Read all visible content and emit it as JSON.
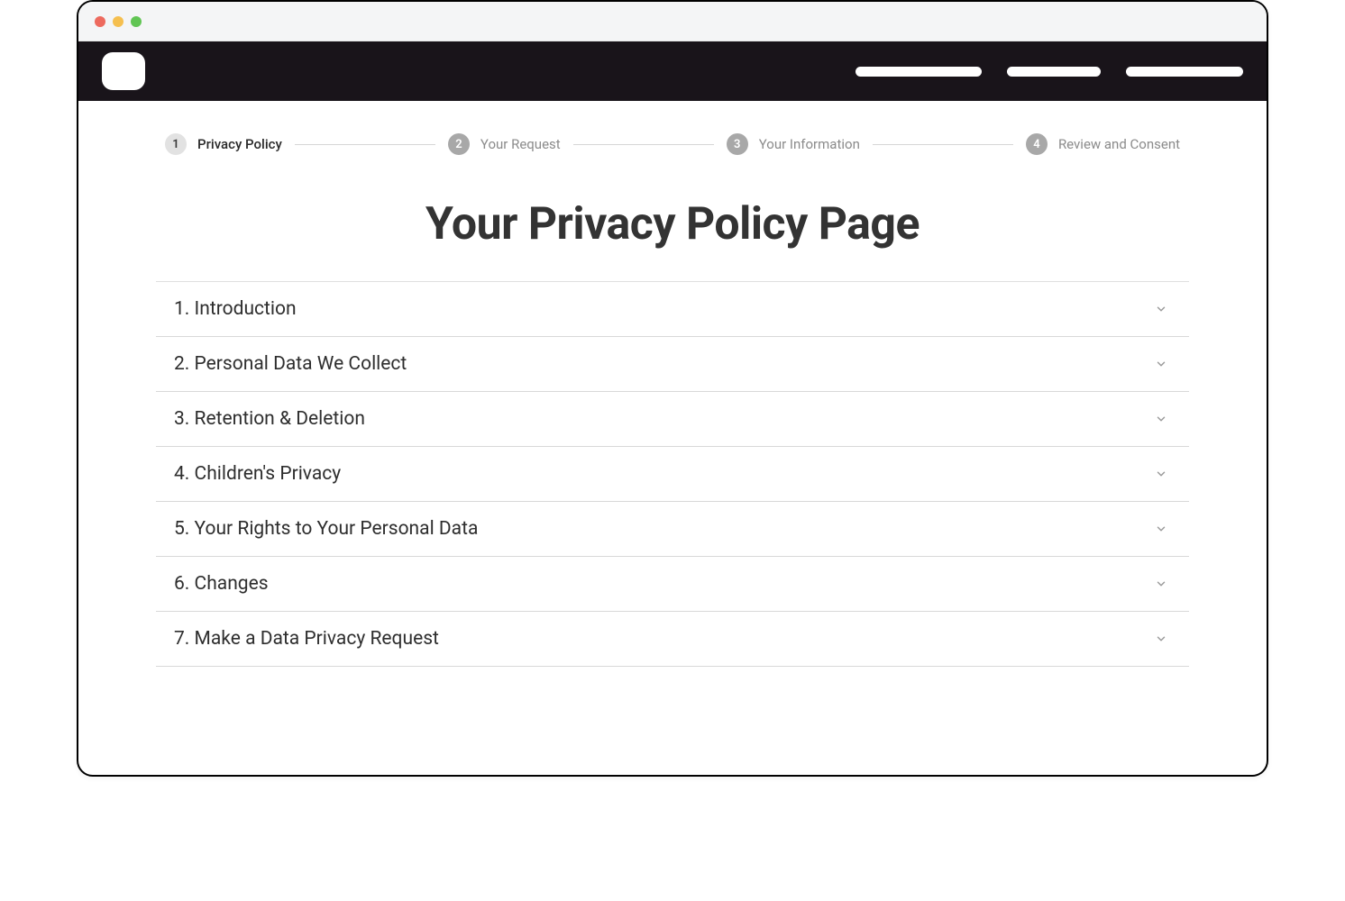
{
  "stepper": {
    "steps": [
      {
        "num": "1",
        "label": "Privacy Policy",
        "state": "active"
      },
      {
        "num": "2",
        "label": "Your Request",
        "state": "upcoming"
      },
      {
        "num": "3",
        "label": "Your Information",
        "state": "upcoming"
      },
      {
        "num": "4",
        "label": "Review and Consent",
        "state": "upcoming"
      }
    ]
  },
  "main": {
    "title": "Your Privacy Policy Page",
    "sections": [
      "1. Introduction",
      "2. Personal Data We Collect",
      "3. Retention & Deletion",
      "4. Children's Privacy",
      "5. Your Rights to Your Personal Data",
      "6. Changes",
      "7. Make a Data Privacy Request"
    ]
  }
}
